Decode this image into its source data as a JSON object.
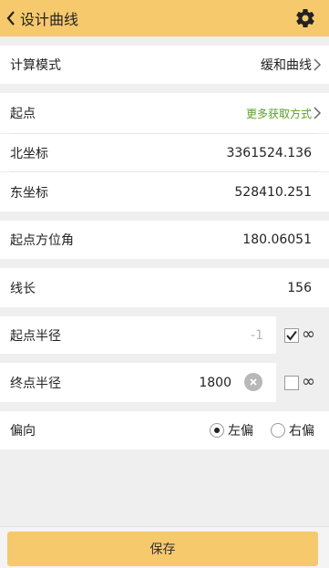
{
  "header": {
    "title": "设计曲线",
    "back_icon": "chevron-left-icon",
    "settings_icon": "gear-icon"
  },
  "calc_mode": {
    "label": "计算模式",
    "value": "缓和曲线"
  },
  "start_point": {
    "label": "起点",
    "link": "更多获取方式"
  },
  "north": {
    "label": "北坐标",
    "value": "3361524.136"
  },
  "east": {
    "label": "东坐标",
    "value": "528410.251"
  },
  "azimuth": {
    "label": "起点方位角",
    "value": "180.06051"
  },
  "length": {
    "label": "线长",
    "value": "156"
  },
  "start_radius": {
    "label": "起点半径",
    "placeholder": "-1",
    "infinite_checked": true,
    "infinite_symbol": "∞"
  },
  "end_radius": {
    "label": "终点半径",
    "value": "1800",
    "infinite_checked": false,
    "infinite_symbol": "∞"
  },
  "offset": {
    "label": "偏向",
    "options": [
      "左偏",
      "右偏"
    ],
    "selected": "左偏"
  },
  "footer": {
    "save_label": "保存"
  },
  "colors": {
    "accent": "#f7c96d",
    "link_green": "#5aa126"
  }
}
